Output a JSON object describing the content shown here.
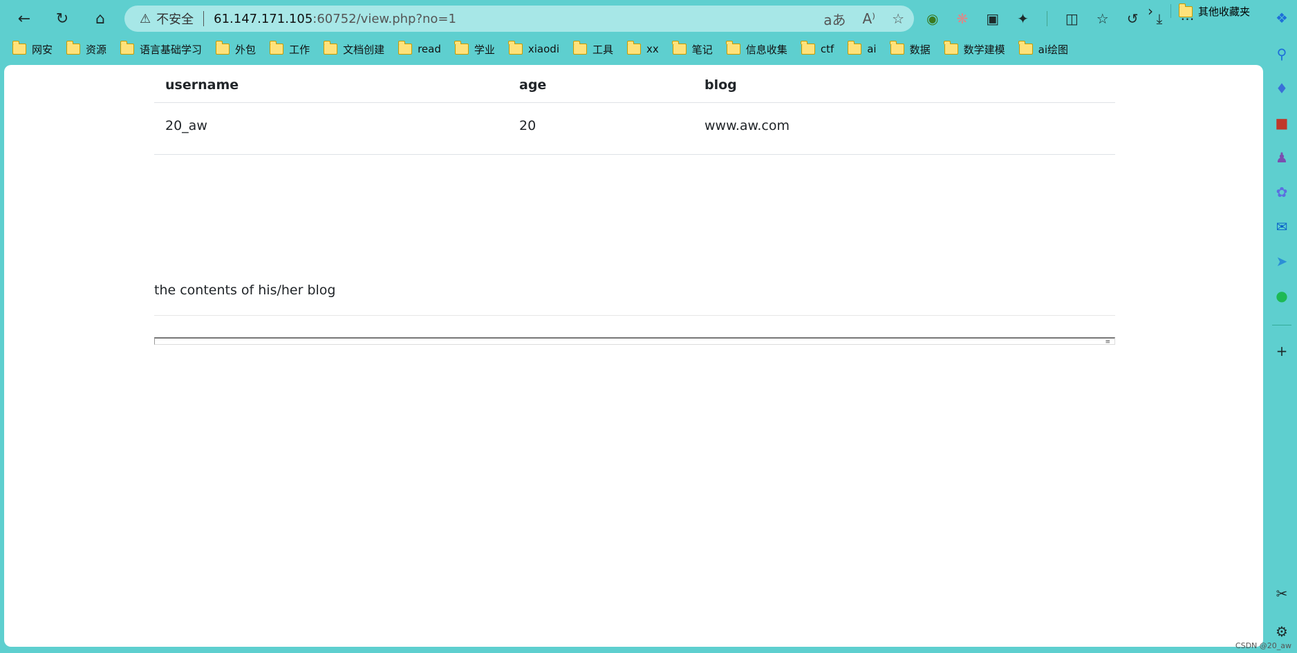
{
  "browser": {
    "insecure_label": "不安全",
    "url_host": "61.147.171.105",
    "url_rest": ":60752/view.php?no=1",
    "bookmarks": [
      "网安",
      "资源",
      "语言基础学习",
      "外包",
      "工作",
      "文档创建",
      "read",
      "学业",
      "xiaodi",
      "工具",
      "xx",
      "笔记",
      "信息收集",
      "ctf",
      "ai",
      "数据",
      "数学建模",
      "ai绘图"
    ],
    "other_bookmarks": "其他收藏夹"
  },
  "table": {
    "headers": [
      "username",
      "age",
      "blog"
    ],
    "rows": [
      [
        "20_aw",
        "20",
        "www.aw.com"
      ]
    ]
  },
  "blog_section": {
    "title": "the contents of his/her blog"
  },
  "watermark": "CSDN @20_aw",
  "colors": {
    "chrome": "#5ecfcf",
    "address_bar": "#a7e7e7",
    "page_bg": "#ffffff"
  }
}
